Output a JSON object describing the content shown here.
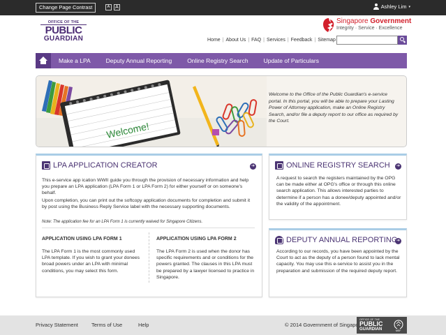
{
  "topbar": {
    "contrast_label": "Change Page Contrast",
    "font_small": "A",
    "font_large": "A",
    "user_name": "Ashley Lim",
    "user_caret": "▾"
  },
  "header": {
    "logo_line1": "OFFICE OF THE",
    "logo_line2": "PUBLIC",
    "logo_line3": "GUARDIAN",
    "sg_name": "Singapore",
    "sg_gov": "Government",
    "sg_tagline": "Integrity · Service · Excellence",
    "nav": [
      "Home",
      "About Us",
      "FAQ",
      "Services",
      "Feedback",
      "Sitemap"
    ],
    "search_placeholder": ""
  },
  "mainnav": {
    "items": [
      "Make a LPA",
      "Deputy Annual Reporting",
      "Online Registry Search",
      "Update of Particulars"
    ]
  },
  "banner": {
    "welcome_word": "Welcome!",
    "text": "Welcome to the Office of the Public Guardian's e-service portal.  In this portal, you will be able to prepare your Lasting Power of Attorney application, make an Online Registry Search, and/or file a deputy report to our office as required by the Court."
  },
  "lpa": {
    "title": "LPA APPLICATION CREATOR",
    "para1": "This e-service app ication WWII guide you through the provision of necessary information and help you prepare an LPA application (LPA Form 1 or LPA Form 2) for either yourself or on someone's behalf.",
    "para2": "Upon completion, you can print out the softcopy application documents for completion and submit it by post using the Business Reply Service label with the necessary supporting documents.",
    "note": "Note: The application fee for an LPA Form 1 is currently waived for Singapore Citizens.",
    "form1_title": "APPLICATION USING LPA FORM 1",
    "form1_text": "The LPA Form 1 is the most commonly used LPA template.  If you wish to grant your donees broad powers under an LPA with minimal conditions, you may select this form.",
    "form2_title": "APPLICATION USING LPA FORM 2",
    "form2_text": "The LPA Form 2 is used when the donor has specific requirements and or conditions for the powers granted.  The clauses in this LPA must be prepared by a lawyer licensed to practice in Singapore."
  },
  "ors": {
    "title": "ONLINE REGISTRY SEARCH",
    "text": "A request to search the registers maintained by the OPG can be made either at OPG's office or through this online search application.  This allows interested parties to determine if a person has a donee/deputy appointed and/or the validity of the appointment."
  },
  "dar": {
    "title": "DEPUTY ANNUAL REPORTING",
    "text": "According to our records, you have been appointed by the Court to act as the deputy of a person found to lack mental capacity.  You may use this e-service to assist you in the preparation and submission of the required deputy report."
  },
  "arrow_glyph": "➔",
  "footer": {
    "links": [
      "Privacy Statement",
      "Terms of Use",
      "Help"
    ],
    "copyright": "© 2014 Government of Singapore",
    "logo_line1": "OFFICE OF THE",
    "logo_line2": "PUBLIC",
    "logo_line3": "GUARDIAN",
    "msf": "MSF"
  },
  "colors": {
    "brand_purple": "#7e59a8",
    "title_purple": "#4b3473",
    "panel_accent": "#a9cde6",
    "sg_red": "#d21f2b"
  }
}
